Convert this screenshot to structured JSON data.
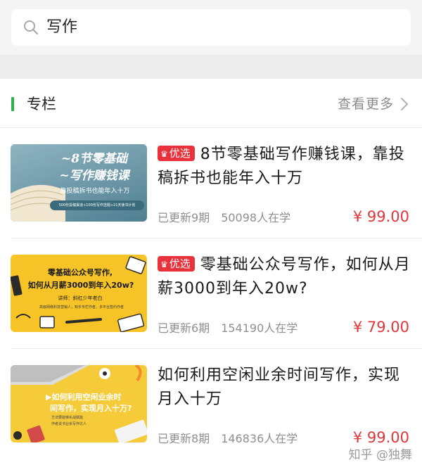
{
  "search": {
    "query": "写作",
    "icon": "search-icon"
  },
  "section": {
    "title": "专栏",
    "more": "查看更多",
    "accent": "#2bb24c"
  },
  "items": [
    {
      "badge": "优选",
      "title": "8节零基础写作赚钱课，靠投稿拆书也能年入十万",
      "updates": "已更新9期",
      "learners": "50098人在学",
      "price": "¥ 99.00",
      "cover": {
        "line1": "~8节零基础",
        "line2": "~写作赚钱课",
        "line3": "靠投稿拆书也能年入十万",
        "line4": "500份投稿渠道+100份写作选题+21天读书计划"
      }
    },
    {
      "badge": "优选",
      "title": "零基础公众号写作，如何从月薪3000到年入20w?",
      "updates": "已更新6期",
      "learners": "154190人在学",
      "price": "¥ 79.00",
      "cover": {
        "line1": "零基础公众号写作,",
        "line2": "如何从月薪3000到年入20w?",
        "line3": "讲师：斜杠少年老白",
        "line4": "高级网络科技营销人，知乎专栏作者，多平台签约作者"
      }
    },
    {
      "badge": "",
      "title": "如何利用空闲业余时间写作，实现月入十万",
      "updates": "已更新8期",
      "learners": "146836人在学",
      "price": "¥ 99.00",
      "cover": {
        "line1": "▶如何利用空闲业余时",
        "line2": "间写作，实现月入十万?",
        "line3": "方法要能够实战赋能",
        "line4": "作者说书业余写作达人"
      }
    }
  ],
  "watermark": "知乎 @独舞",
  "colors": {
    "price": "#e0363c",
    "badge": "#e8313b",
    "cover2_bg": "#f7c428",
    "cover1_bg": "#7fa6b4"
  }
}
